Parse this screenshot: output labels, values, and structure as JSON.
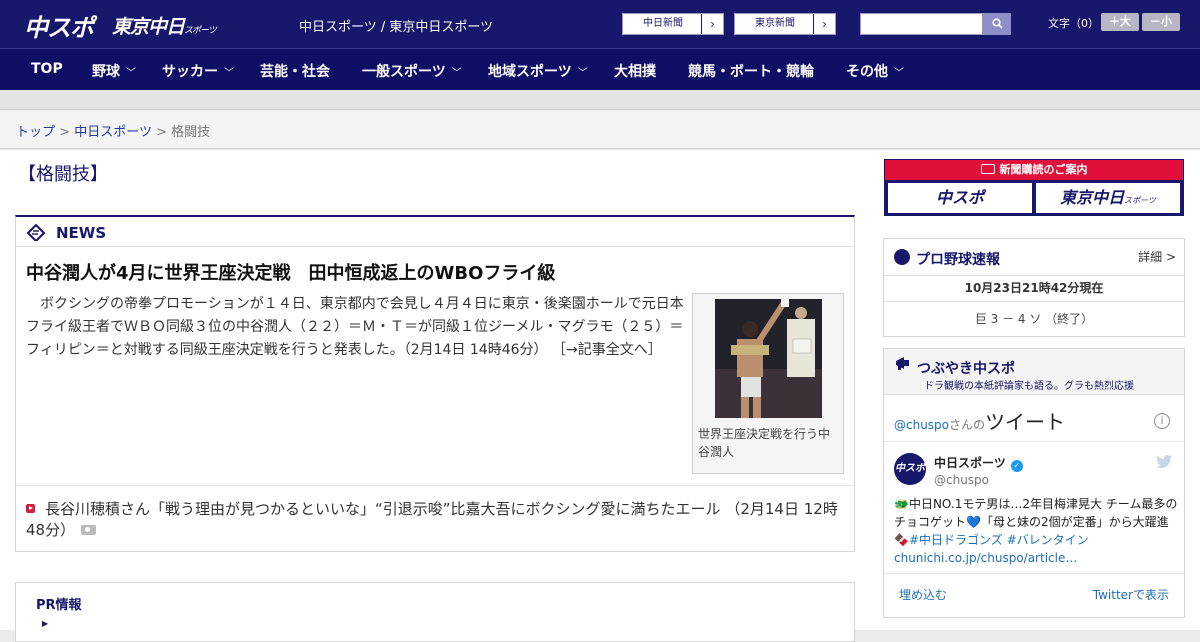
{
  "header": {
    "logo_chunichi": "中スポ",
    "logo_tokyo": "東京中日",
    "logo_tokyo_small": "スポーツ",
    "site_names": "中日スポーツ / 東京中日スポーツ",
    "paper_buttons": [
      {
        "label": "中日新聞"
      },
      {
        "label": "東京新聞"
      }
    ],
    "search_placeholder": "",
    "font_label": "文字（0）",
    "font_larger": "＋大",
    "font_smaller": "－小"
  },
  "nav": {
    "items": [
      {
        "label": "TOP"
      },
      {
        "label": "野球"
      },
      {
        "label": "サッカー"
      },
      {
        "label": "芸能・社会"
      },
      {
        "label": "一般スポーツ"
      },
      {
        "label": "地域スポーツ"
      },
      {
        "label": "大相撲"
      },
      {
        "label": "競馬・ボート・競輪"
      },
      {
        "label": "その他"
      }
    ]
  },
  "breadcrumb": {
    "items": [
      "トップ",
      "中日スポーツ"
    ],
    "separator": ">",
    "current": "格闘技"
  },
  "page": {
    "title": "【格闘技】"
  },
  "news": {
    "label": "NEWS",
    "article": {
      "title": "中谷潤人が4月に世界王座決定戦　田中恒成返上のWBOフライ級",
      "body": "　ボクシングの帝拳プロモーションが１４日、東京都内で会見し４月４日に東京・後楽園ホールで元日本フライ級王者でＷＢＯ同級３位の中谷潤人（２２）＝Ｍ・Ｔ＝が同級１位ジーメル・マグラモ（２５）＝フィリピン＝と対戦する同級王座決定戦を行うと発表した。（2月14日 14時46分）",
      "link": "［→記事全文へ］",
      "photo_caption": "世界王座決定戦を行う中谷潤人"
    },
    "related": {
      "text": "長谷川穂積さん「戦う理由が見つかるといいな」“引退示唆”比嘉大吾にボクシング愛に満ちたエール",
      "date": "（2月14日 12時48分）"
    }
  },
  "pr": {
    "title": "PR情報"
  },
  "sidebar": {
    "subscription": {
      "header": "新聞購読のご案内",
      "btn_chunichi": "中スポ",
      "btn_tokyo": "東京中日",
      "btn_tokyo_small": "スポーツ"
    },
    "baseball": {
      "title": "プロ野球速報",
      "detail": "詳細 >",
      "time": "10月23日21時42分現在",
      "score": "巨 3 － 4 ソ （終了）"
    },
    "twitter": {
      "title": "つぶやき中スポ",
      "subtitle": "ドラ観戦の本紙評論家も語る。グラも熱烈応援",
      "handle_link": "@chuspo",
      "handle_suffix": "さんの",
      "headline": "ツイート",
      "info": "i",
      "avatar_text": "中スポ",
      "account_name": "中日スポーツ",
      "verified": "✓",
      "account_handle": "@chuspo",
      "tweet_line1": "🐲中日NO.1モテ男は…2年目梅津晃大 チーム最多のチョコゲット💙「母と妹の2個が定番」から大躍進 🍫",
      "tweet_tags": "#中日ドラゴンズ #バレンタイン",
      "tweet_url": "chunichi.co.jp/chuspo/article…",
      "embed": "埋め込む",
      "view": "Twitterで表示"
    }
  },
  "colors": {
    "brand_navy": "#17176b",
    "nav_navy": "#0f0f66",
    "accent_red": "#e0103a",
    "link_blue": "#1d3ea0"
  }
}
